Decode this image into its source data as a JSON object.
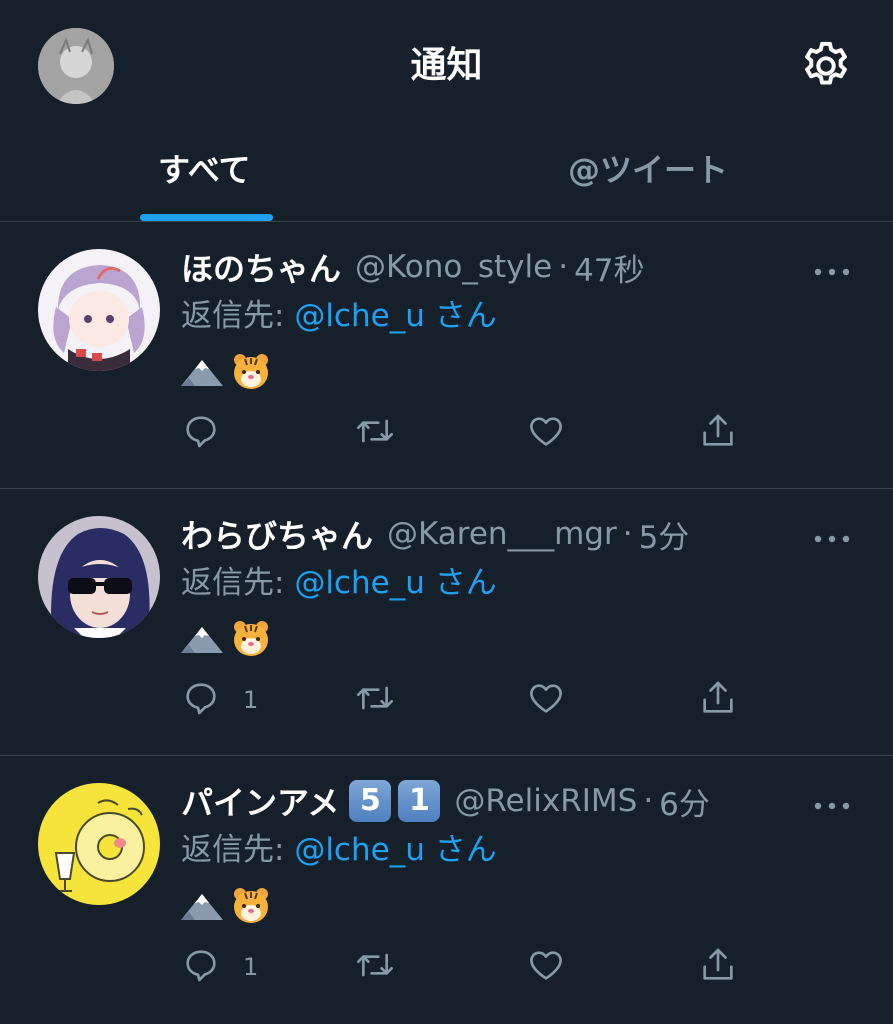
{
  "header": {
    "title": "通知",
    "settings_icon": "gear-icon",
    "profile_icon": "avatar"
  },
  "tabs": [
    {
      "label": "すべて",
      "active": true
    },
    {
      "label": "@ツイート",
      "active": false
    }
  ],
  "colors": {
    "background": "#15202b",
    "accent": "#1da1f2",
    "muted": "#8899a6",
    "divider": "#38444d"
  },
  "tweets": [
    {
      "display_name": "ほのちゃん",
      "badges": [],
      "handle": "@Kono_style",
      "dot": "·",
      "time": "47秒",
      "reply_prefix": "返信先: ",
      "reply_to": "@lche_u",
      "reply_suffix": "さん",
      "emoji": [
        "mountain-icon",
        "tiger-face-icon"
      ],
      "reply_count": ""
    },
    {
      "display_name": "わらびちゃん",
      "badges": [],
      "handle": "@Karen___mgr",
      "dot": "·",
      "time": "5分",
      "reply_prefix": "返信先: ",
      "reply_to": "@lche_u",
      "reply_suffix": "さん",
      "emoji": [
        "mountain-icon",
        "tiger-face-icon"
      ],
      "reply_count": "1"
    },
    {
      "display_name": "パインアメ",
      "badges": [
        "5",
        "1"
      ],
      "handle": "@RelixRIMS",
      "dot": "·",
      "time": "6分",
      "reply_prefix": "返信先: ",
      "reply_to": "@lche_u",
      "reply_suffix": "さん",
      "emoji": [
        "mountain-icon",
        "tiger-face-icon"
      ],
      "reply_count": "1"
    }
  ]
}
